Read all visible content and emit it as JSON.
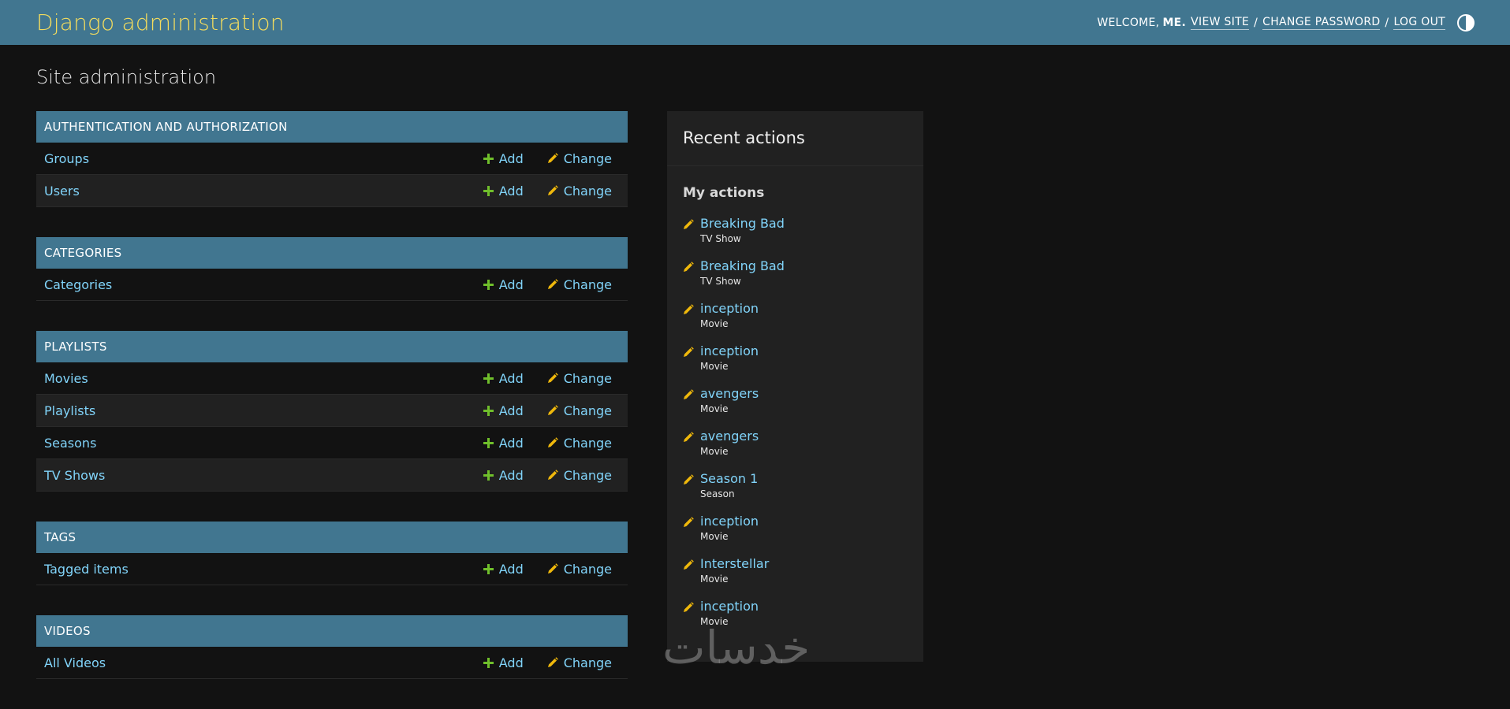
{
  "header": {
    "branding": "Django administration",
    "welcome": "WELCOME,",
    "user": "ME.",
    "view_site": "VIEW SITE",
    "change_password": "CHANGE PASSWORD",
    "log_out": "LOG OUT",
    "separator": "/",
    "theme_icon": "half-circle-icon"
  },
  "page_title": "Site administration",
  "modules": [
    {
      "caption": "AUTHENTICATION AND AUTHORIZATION",
      "models": [
        {
          "name": "Groups",
          "add": "Add",
          "change": "Change"
        },
        {
          "name": "Users",
          "add": "Add",
          "change": "Change"
        }
      ]
    },
    {
      "caption": "CATEGORIES",
      "models": [
        {
          "name": "Categories",
          "add": "Add",
          "change": "Change"
        }
      ]
    },
    {
      "caption": "PLAYLISTS",
      "models": [
        {
          "name": "Movies",
          "add": "Add",
          "change": "Change"
        },
        {
          "name": "Playlists",
          "add": "Add",
          "change": "Change"
        },
        {
          "name": "Seasons",
          "add": "Add",
          "change": "Change"
        },
        {
          "name": "TV Shows",
          "add": "Add",
          "change": "Change"
        }
      ]
    },
    {
      "caption": "TAGS",
      "models": [
        {
          "name": "Tagged items",
          "add": "Add",
          "change": "Change"
        }
      ]
    },
    {
      "caption": "VIDEOS",
      "models": [
        {
          "name": "All Videos",
          "add": "Add",
          "change": "Change"
        }
      ]
    }
  ],
  "recent_actions": {
    "title": "Recent actions",
    "subtitle": "My actions",
    "items": [
      {
        "title": "Breaking Bad",
        "type": "TV Show"
      },
      {
        "title": "Breaking Bad",
        "type": "TV Show"
      },
      {
        "title": "inception",
        "type": "Movie"
      },
      {
        "title": "inception",
        "type": "Movie"
      },
      {
        "title": "avengers",
        "type": "Movie"
      },
      {
        "title": "avengers",
        "type": "Movie"
      },
      {
        "title": "Season 1",
        "type": "Season"
      },
      {
        "title": "inception",
        "type": "Movie"
      },
      {
        "title": "Interstellar",
        "type": "Movie"
      },
      {
        "title": "inception",
        "type": "Movie"
      }
    ]
  },
  "watermark": "خدسات",
  "colors": {
    "header_bg": "#417690",
    "branding": "#f5dd5d",
    "link": "#81d4fa",
    "add_icon": "#70bf2b",
    "change_icon": "#efb80b",
    "body_bg": "#121212",
    "panel_bg": "#212121"
  }
}
